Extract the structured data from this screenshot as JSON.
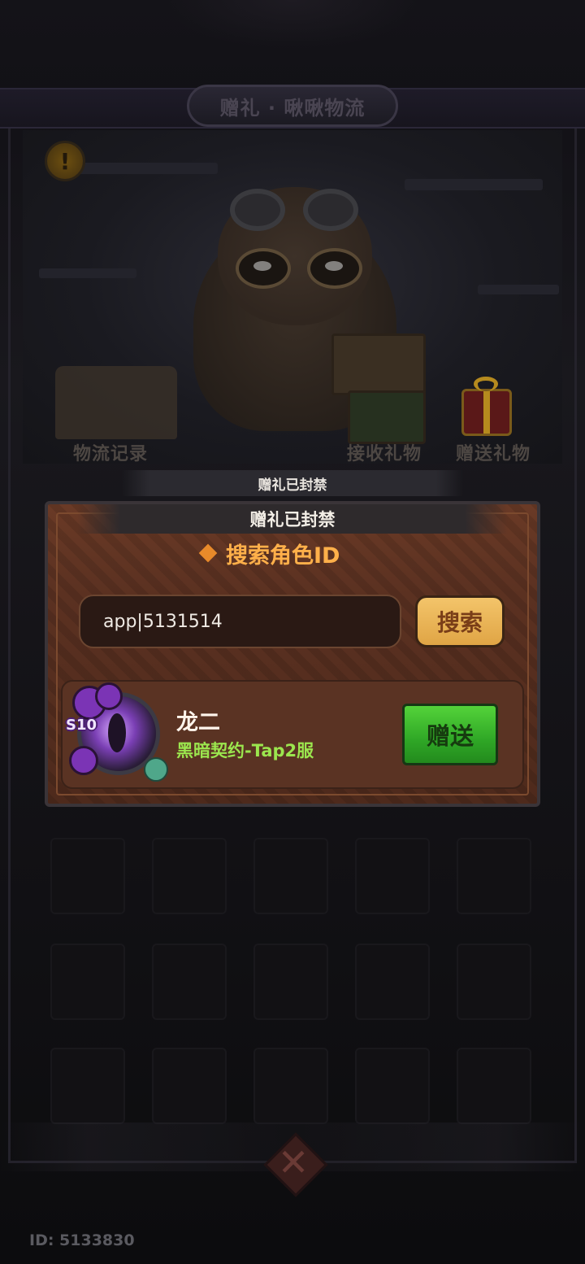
{
  "header": {
    "title": "赠礼 · 啾啾物流"
  },
  "scene": {
    "left_label": "物流记录",
    "middle_label": "接收礼物",
    "right_label": "赠送礼物",
    "alert_glyph": "!"
  },
  "banner_top": "赠礼已封禁",
  "panel": {
    "banner": "赠礼已封禁",
    "title": "搜索角色ID",
    "search_value": "app|5131514",
    "search_button": "搜索"
  },
  "result": {
    "level": "S10",
    "name": "龙二",
    "server": "黑暗契约-Tap2服",
    "gift_button": "赠送"
  },
  "close_glyph": "✕",
  "footer": {
    "id": "ID: 5133830"
  },
  "colors": {
    "accent_orange": "#ffb04a",
    "server_green": "#9be64e",
    "gift_button_green": "#2fa726",
    "search_button_gold": "#e0a545"
  }
}
